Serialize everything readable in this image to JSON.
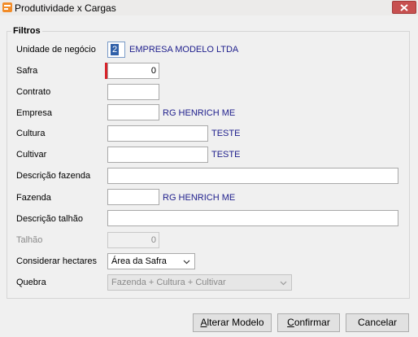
{
  "window": {
    "title": "Produtividade x Cargas"
  },
  "group": {
    "title": "Filtros"
  },
  "fields": {
    "unidade_negocio": {
      "label": "Unidade de negócio",
      "value": "2",
      "description": "EMPRESA MODELO LTDA"
    },
    "safra": {
      "label": "Safra",
      "value": "0"
    },
    "contrato": {
      "label": "Contrato",
      "value": ""
    },
    "empresa": {
      "label": "Empresa",
      "value": "",
      "description": "RG HENRICH ME"
    },
    "cultura": {
      "label": "Cultura",
      "value": "",
      "description": "TESTE"
    },
    "cultivar": {
      "label": "Cultivar",
      "value": "",
      "description": "TESTE"
    },
    "descricao_fazenda": {
      "label": "Descrição fazenda",
      "value": ""
    },
    "fazenda": {
      "label": "Fazenda",
      "value": "",
      "description": "RG HENRICH ME"
    },
    "descricao_talhao": {
      "label": "Descrição talhão",
      "value": ""
    },
    "talhao": {
      "label": "Talhão",
      "value": "0"
    },
    "considerar_hectares": {
      "label": "Considerar hectares",
      "selected": "Área da Safra"
    },
    "quebra": {
      "label": "Quebra",
      "selected": "Fazenda + Cultura + Cultivar"
    }
  },
  "buttons": {
    "alterar_modelo": {
      "accel": "A",
      "rest": "lterar Modelo"
    },
    "confirmar": {
      "accel": "C",
      "rest": "onfirmar"
    },
    "cancelar": {
      "label": "Cancelar"
    }
  },
  "colors": {
    "description_text": "#1e1e8c",
    "required_marker": "#d8232a",
    "close_button": "#c75050"
  }
}
